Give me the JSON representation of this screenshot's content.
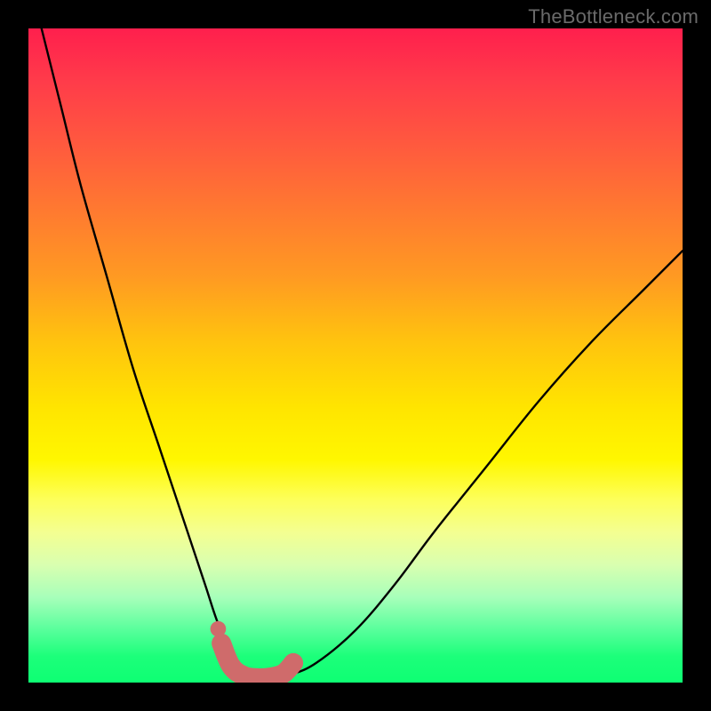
{
  "watermark": "TheBottleneck.com",
  "colors": {
    "background": "#000000",
    "curve": "#000000",
    "marker": "#cf6b6b",
    "gradient_top": "#ff1f4d",
    "gradient_bottom": "#0eff73"
  },
  "chart_data": {
    "type": "line",
    "title": "",
    "xlabel": "",
    "ylabel": "",
    "xlim": [
      0,
      100
    ],
    "ylim": [
      0,
      100
    ],
    "grid": false,
    "series": [
      {
        "name": "bottleneck-curve",
        "x": [
          2,
          5,
          8,
          12,
          16,
          20,
          24,
          27,
          29,
          31,
          33,
          35,
          37,
          40,
          44,
          50,
          56,
          62,
          70,
          78,
          86,
          94,
          100
        ],
        "y": [
          100,
          88,
          76,
          62,
          48,
          36,
          24,
          15,
          9,
          5,
          2,
          0.8,
          0.6,
          1.2,
          3,
          8,
          15,
          23,
          33,
          43,
          52,
          60,
          66
        ]
      }
    ],
    "highlight": {
      "name": "minimum-region",
      "x": [
        29.5,
        31,
        33,
        35,
        37,
        39,
        40.5
      ],
      "y": [
        6,
        2.5,
        1.0,
        0.7,
        0.8,
        1.4,
        3.0
      ]
    },
    "highlight_dot": {
      "x": 29,
      "y": 8.2
    }
  }
}
